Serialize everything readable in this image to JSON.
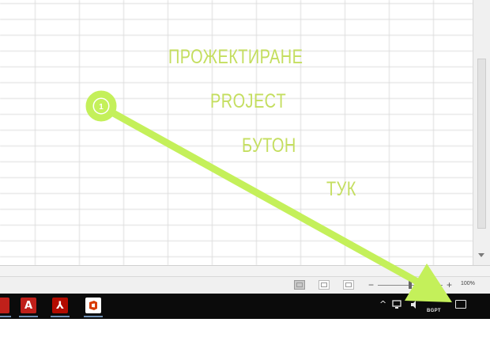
{
  "annotation": {
    "lines": [
      "ПРОЖЕКТИРАНЕ",
      "PROJECT",
      "БУТОН",
      "ТУК"
    ],
    "step_number": "1",
    "color": "#c4de5f"
  },
  "statusbar": {
    "zoom_level": "100%",
    "zoom_minus": "−",
    "zoom_plus": "+"
  },
  "taskbar": {
    "apps": [
      {
        "icon": "access-app-icon",
        "glyph": "A",
        "color": "#c0201a"
      },
      {
        "icon": "pdf-app-icon",
        "glyph": "⅄",
        "color": "#b30b00"
      },
      {
        "icon": "office-app-icon",
        "glyph": "◘",
        "color": "#d83b01"
      }
    ],
    "tray_chevron": "^",
    "language": "BGPT"
  }
}
